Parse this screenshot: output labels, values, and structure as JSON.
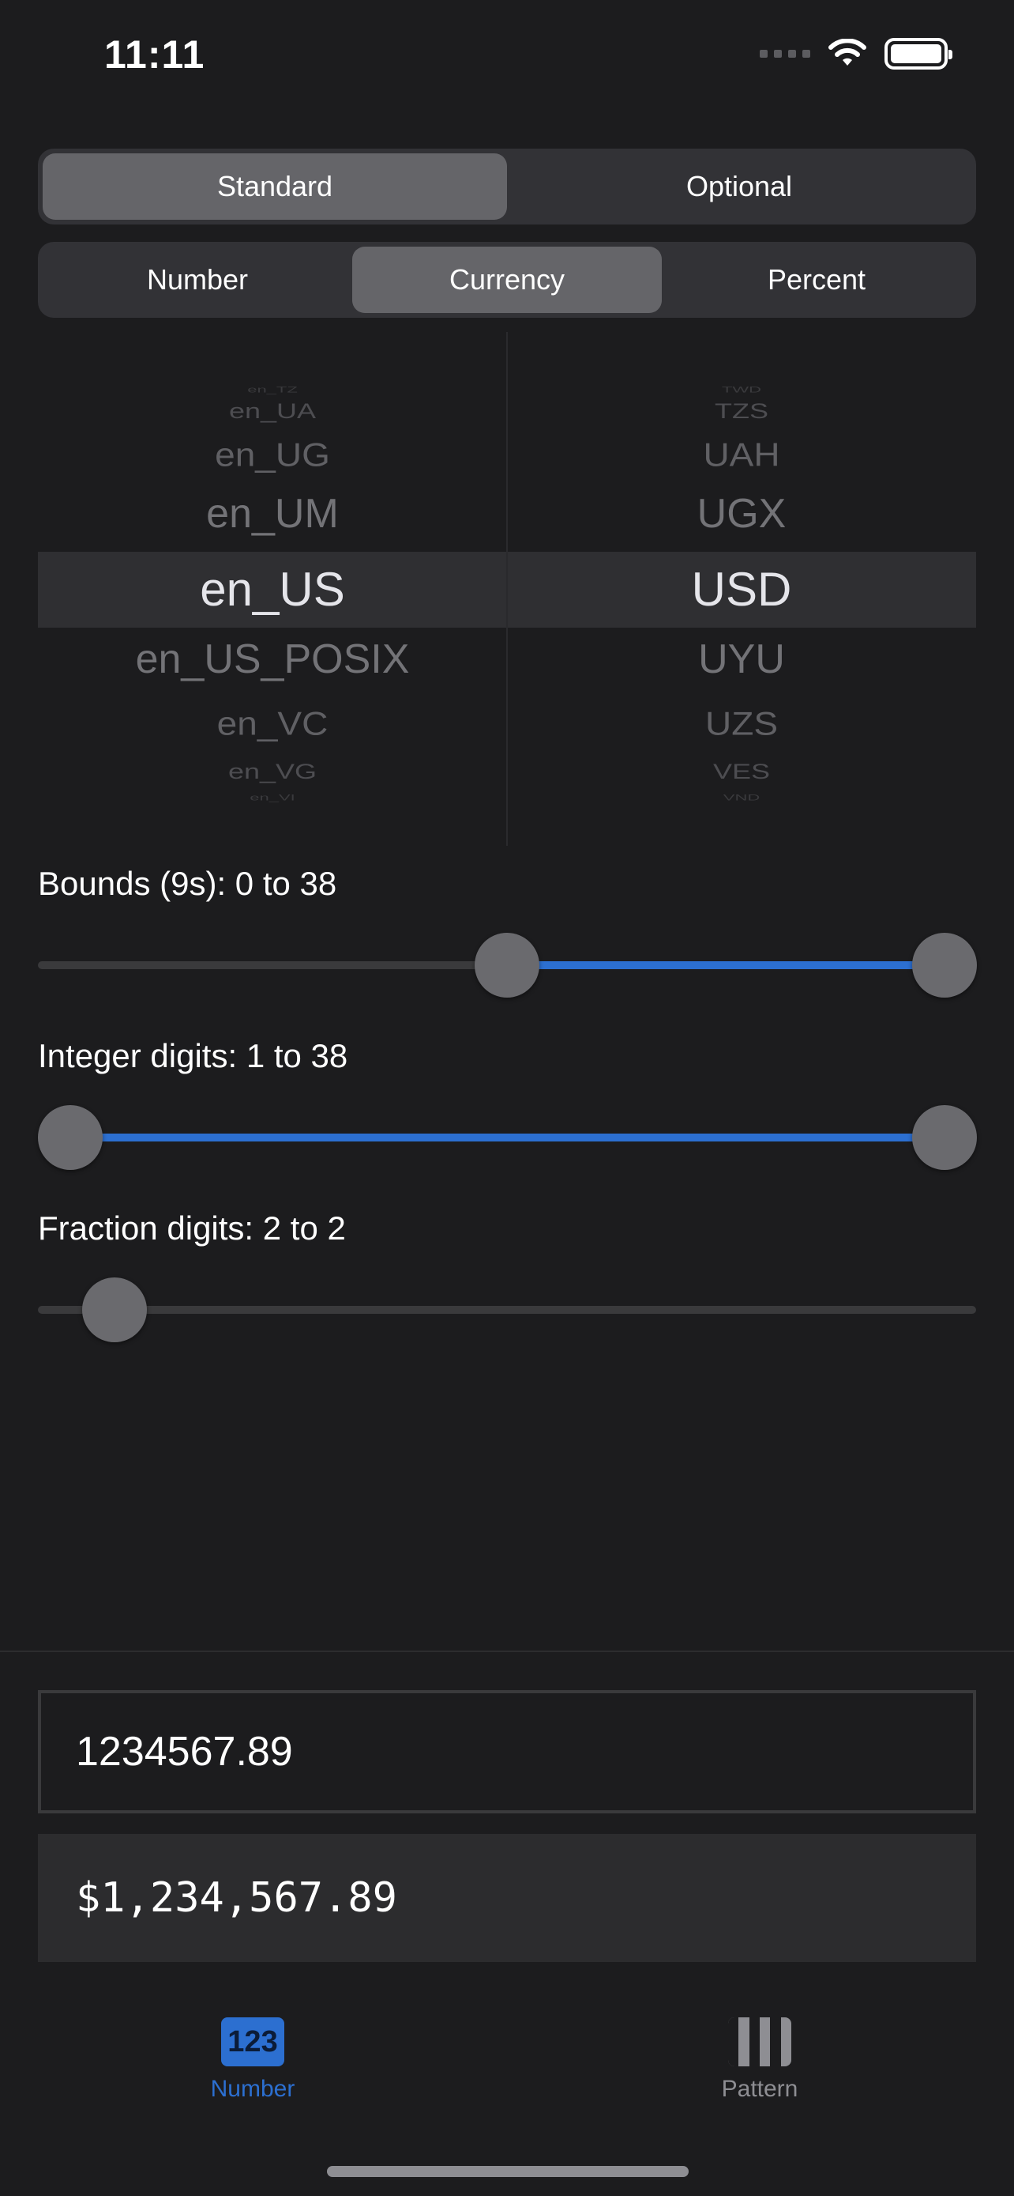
{
  "status_bar": {
    "time": "11:11"
  },
  "format_style": {
    "options": [
      "Standard",
      "Optional"
    ],
    "selected": "Standard"
  },
  "format_kind": {
    "options": [
      "Number",
      "Currency",
      "Percent"
    ],
    "selected": "Currency"
  },
  "picker": {
    "locales": [
      "en_TZ",
      "en_UA",
      "en_UG",
      "en_UM",
      "en_US",
      "en_US_POSIX",
      "en_VC",
      "en_VG",
      "en_VI"
    ],
    "currencies": [
      "TWD",
      "TZS",
      "UAH",
      "UGX",
      "USD",
      "UYU",
      "UZS",
      "VES",
      "VND"
    ],
    "selected_locale": "en_US",
    "selected_currency": "USD"
  },
  "sliders": {
    "bounds": {
      "label": "Bounds (9s): 0 to 38",
      "min": 0,
      "max": 38,
      "lower": 0,
      "upper": 38
    },
    "integer_digits": {
      "label": "Integer digits: 1 to 38",
      "min": 1,
      "max": 38,
      "lower": 1,
      "upper": 38
    },
    "fraction_digits": {
      "label": "Fraction digits: 2 to 2",
      "min": 2,
      "max": 2,
      "lower": 2,
      "upper": 2
    }
  },
  "input": {
    "value": "1234567.89"
  },
  "output": {
    "value": "$1,234,567.89"
  },
  "tab_bar": {
    "tabs": [
      {
        "label": "Number",
        "icon": "123-icon",
        "selected": true
      },
      {
        "label": "Pattern",
        "icon": "checkerboard-icon",
        "selected": false
      }
    ]
  },
  "colors": {
    "accent": "#2c6fd0",
    "background": "#1c1c1e"
  }
}
